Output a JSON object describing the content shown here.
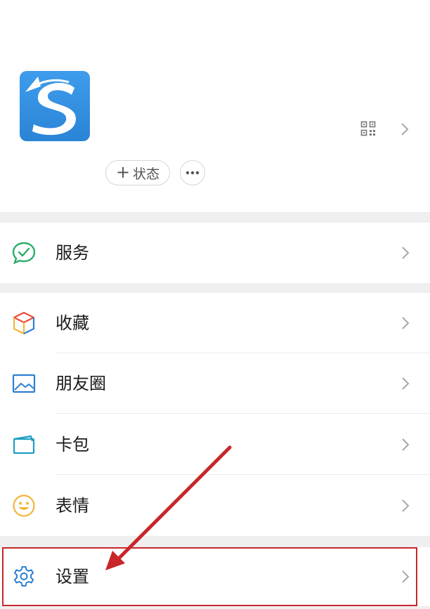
{
  "profile": {
    "status_label": "状态",
    "status_plus": "+"
  },
  "menu": {
    "services": {
      "label": "服务"
    },
    "favorites": {
      "label": "收藏"
    },
    "moments": {
      "label": "朋友圈"
    },
    "cards": {
      "label": "卡包"
    },
    "stickers": {
      "label": "表情"
    },
    "settings": {
      "label": "设置"
    }
  },
  "icons": {
    "qr": "qr-code-icon",
    "chevron": "chevron-right-icon",
    "services": "services-icon",
    "favorites": "cube-icon",
    "moments": "landscape-image-icon",
    "cards": "card-wallet-icon",
    "stickers": "smiley-face-icon",
    "settings": "gear-icon"
  },
  "colors": {
    "background": "#ffffff",
    "separator": "#efefef",
    "text": "#1a1a1a",
    "highlight": "#c7272a",
    "avatar_blue": "#2f8ee0",
    "services_green": "#2aae67",
    "moments_blue": "#2e7fd1",
    "cards_teal": "#1e9ec2",
    "stickers_yellow": "#f2b53b",
    "settings_blue": "#2e7fd1"
  }
}
